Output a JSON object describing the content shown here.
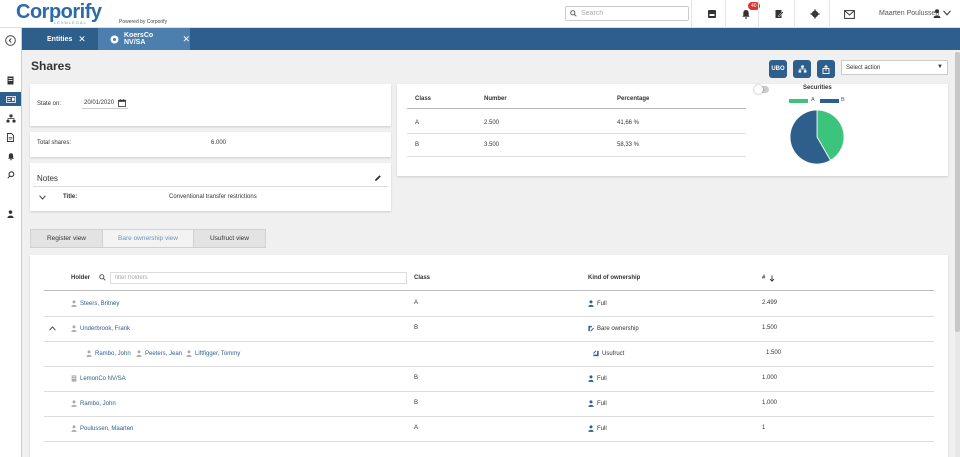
{
  "header": {
    "logo": "Corporify",
    "logo_sub": "LEXMLEGAL",
    "powered_by": "Powered by Corporify",
    "search_placeholder": "Search",
    "notification_count": "40",
    "user_name": "Maarten Poulussen"
  },
  "tabs": [
    {
      "label": "Entities"
    },
    {
      "label": "KoersCo NV/SA"
    }
  ],
  "page": {
    "title": "Shares",
    "ubo_label": "UBO",
    "select_action": "Select action"
  },
  "state": {
    "label": "State on:",
    "date": "20/01/2020"
  },
  "total": {
    "label": "Total shares:",
    "value": "6.000"
  },
  "notes": {
    "heading": "Notes",
    "title_label": "Title:",
    "title_value": "Conventional transfer restrictions"
  },
  "securities": {
    "headers": {
      "class": "Class",
      "number": "Number",
      "percentage": "Percentage"
    },
    "rows": [
      {
        "class": "A",
        "number": "2.500",
        "percentage": "41,66 %"
      },
      {
        "class": "B",
        "number": "3.500",
        "percentage": "58,33 %"
      }
    ]
  },
  "chart_data": {
    "type": "pie",
    "title": "Securities",
    "categories": [
      "A",
      "B"
    ],
    "values": [
      2500,
      3500
    ],
    "colors": [
      "#3cc47c",
      "#2e5e8c"
    ],
    "legend": "top"
  },
  "views": [
    {
      "label": "Register view"
    },
    {
      "label": "Bare ownership view"
    },
    {
      "label": "Usufruct view"
    }
  ],
  "holders": {
    "headers": {
      "holder": "Holder",
      "class": "Class",
      "kind": "Kind of ownership",
      "count": "#"
    },
    "filter_placeholder": "filter holders",
    "rows": [
      {
        "name": "Steers, Britney",
        "class": "A",
        "kind": "Full",
        "count": "2.499"
      },
      {
        "name": "Underbrook, Frank",
        "class": "B",
        "kind": "Bare ownership",
        "count": "1.500"
      },
      {
        "sub1": "Rambo, John",
        "sub2": "Peeters, Jean",
        "sub3": "Liftfigger, Tommy",
        "kind": "Usufruct",
        "count": "1.500"
      },
      {
        "name": "LemonCo NV/SA",
        "class": "B",
        "kind": "Full",
        "count": "1.000"
      },
      {
        "name": "Rambo, John",
        "class": "B",
        "kind": "Full",
        "count": "1.000"
      },
      {
        "name": "Poulussen, Maarten",
        "class": "A",
        "kind": "Full",
        "count": "1"
      }
    ]
  },
  "colors": {
    "primary": "#2e5e8c",
    "accent_green": "#3cc47c",
    "badge_red": "#d33"
  }
}
